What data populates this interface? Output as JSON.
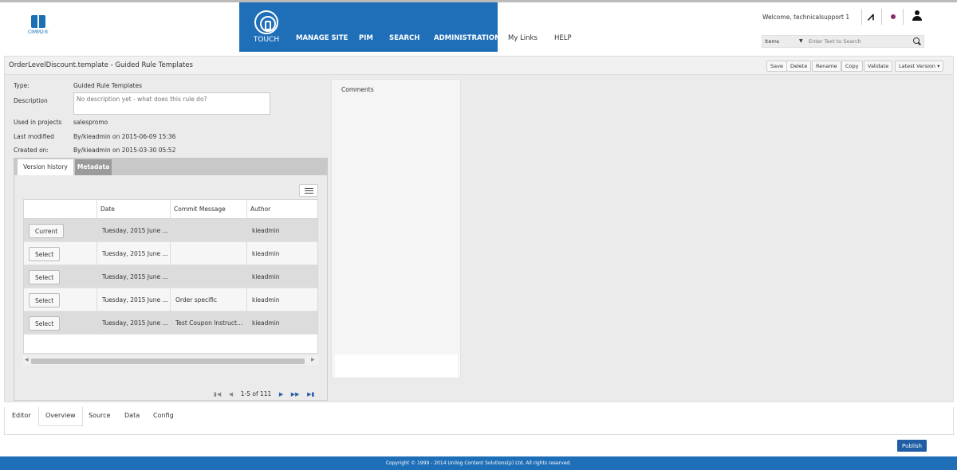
{
  "header": {
    "logo_text": "CIMM2®",
    "nav": {
      "touch": "TOUCH",
      "items": [
        "MANAGE SITE",
        "PIM",
        "SEARCH",
        "ADMINISTRATION"
      ],
      "plain": [
        "My Links",
        "HELP"
      ]
    },
    "welcome": "Welcome, technicalsupport 1",
    "search": {
      "scope": "Items",
      "placeholder": "Enter Text to Search"
    }
  },
  "page": {
    "title": "OrderLevelDiscount.template - Guided Rule Templates",
    "toolbar": [
      "Save",
      "Delete",
      "Rename",
      "Copy",
      "Validate",
      "Latest Version ▾"
    ]
  },
  "info": {
    "type_label": "Type:",
    "type_value": "Guided Rule Templates",
    "description_label": "Description",
    "description_placeholder": "No description yet - what does this rule do?",
    "used_label": "Used in projects",
    "used_value": "salespromo",
    "modified_label": "Last modified",
    "modified_value": "By/kieadmin on 2015-06-09 15:36",
    "created_label": "Created on:",
    "created_value": "By/kieadmin on 2015-03-30 05:52"
  },
  "tabs": {
    "version_history": "Version history",
    "metadata": "Metadata"
  },
  "versions": {
    "columns": [
      "",
      "Date",
      "Commit Message",
      "Author"
    ],
    "rows": [
      {
        "button": "Current",
        "date": "Tuesday, 2015 June ...",
        "message": "",
        "author": "kieadmin"
      },
      {
        "button": "Select",
        "date": "Tuesday, 2015 June ...",
        "message": "",
        "author": "kieadmin"
      },
      {
        "button": "Select",
        "date": "Tuesday, 2015 June ...",
        "message": "",
        "author": "kieadmin"
      },
      {
        "button": "Select",
        "date": "Tuesday, 2015 June ...",
        "message": "Order specific",
        "author": "kieadmin"
      },
      {
        "button": "Select",
        "date": "Tuesday, 2015 June ...",
        "message": "Test Coupon Instruct...",
        "author": "kieadmin"
      }
    ],
    "pager": "1-5 of 111"
  },
  "comments": {
    "title": "Comments"
  },
  "bottom_tabs": [
    "Editor",
    "Overview",
    "Source",
    "Data",
    "Config"
  ],
  "publish": "Publish",
  "footer": "Copyright © 1999 - 2014 Unilog Content Solutions(p) Ltd. All rights reserved."
}
